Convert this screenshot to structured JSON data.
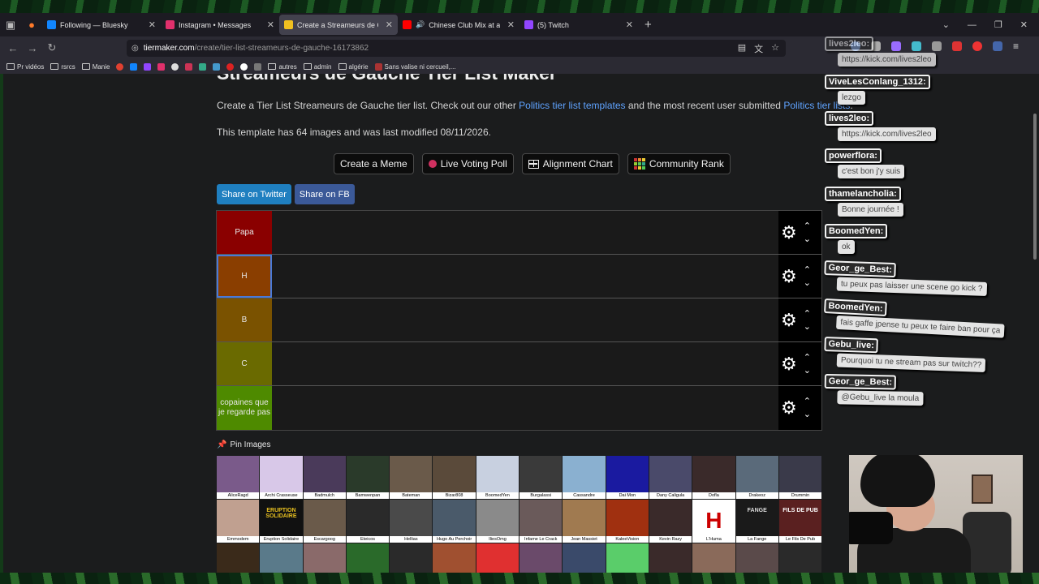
{
  "browser": {
    "tabs": [
      {
        "title": "Following — Bluesky",
        "favicon_color": "#1185fe",
        "active": false
      },
      {
        "title": "Instagram • Messages",
        "favicon_color": "#e1306c",
        "active": false
      },
      {
        "title": "Create a Streameurs de Gauche",
        "favicon_color": "#f0c020",
        "active": true
      },
      {
        "title": "Chinese Club Mix at a Senio",
        "favicon_color": "#ff0000",
        "active": false
      },
      {
        "title": "(5) Twitch",
        "favicon_color": "#9146ff",
        "active": false
      }
    ],
    "new_tab_glyph": "+",
    "url_host": "tiermaker.com",
    "url_path": "/create/tier-list-streameurs-de-gauche-16173862",
    "bookmarks": [
      {
        "label": "Pr vidéos",
        "type": "folder"
      },
      {
        "label": "rsrcs",
        "type": "folder"
      },
      {
        "label": "Manie",
        "type": "folder"
      },
      {
        "label": "autres",
        "type": "folder"
      },
      {
        "label": "admin",
        "type": "folder"
      },
      {
        "label": "algérie",
        "type": "folder"
      },
      {
        "label": "Sans valise ni cercueil,...",
        "type": "link"
      }
    ]
  },
  "page": {
    "title": "Streameurs de Gauche Tier List Maker",
    "intro_pre": "Create a Tier List Streameurs de Gauche tier list. Check out our other ",
    "intro_link1": "Politics tier list templates",
    "intro_mid": " and the most recent user submitted ",
    "intro_link2": "Politics tier lists",
    "intro_post": ".",
    "template_info": "This template has 64 images and was last modified 08/11/2026.",
    "buttons": {
      "create_meme": "Create a Meme",
      "live_voting": "Live Voting Poll",
      "alignment": "Alignment Chart",
      "community": "Community Rank"
    },
    "share": {
      "twitter": "Share on Twitter",
      "fb": "Share on FB",
      "twitter_color": "#1f7fc0",
      "fb_color": "#3b5998"
    },
    "tiers": [
      {
        "label": "Papa",
        "color": "#8a0000"
      },
      {
        "label": "H",
        "color": "#8a3e00"
      },
      {
        "label": "B",
        "color": "#7a5200"
      },
      {
        "label": "C",
        "color": "#6a6a00"
      },
      {
        "label": "copaines que je regarde pas",
        "color": "#4e8a00"
      }
    ],
    "pin_images": "Pin Images",
    "images_row1": [
      "AliceRagd",
      "Archi Crasseuse",
      "Badmulch",
      "Bamwenpan",
      "Bateman",
      "Bizar808",
      "BoomedYen",
      "Burgalassi",
      "Cassandre",
      "Dai Mon",
      "Dany Caligula",
      "Dofla",
      "Drakeoz",
      "Drummin"
    ],
    "images_row2": [
      "Emmodem",
      "Eruption Solidaire",
      "Escargoog",
      "Eteicos",
      "Hellias",
      "Hugo Au Perchoir",
      "IliesOmg",
      "Infame Le Crack",
      "Jean Massiet",
      "KaleeVision",
      "Kevin Razy",
      "L'Huma",
      "La Fange",
      "Le Fils De Pub"
    ],
    "image_text": {
      "eruption": "ERUPTION SOLIDAIRE",
      "huma": "H",
      "fils": "FILS DE PUB",
      "fange": "FANGE"
    }
  },
  "chat": [
    {
      "user": "lives2leo:",
      "text": "https://kick.com/lives2leo"
    },
    {
      "user": "ViveLesConlang_1312:",
      "text": "lezgo"
    },
    {
      "user": "lives2leo:",
      "text": "https://kick.com/lives2leo"
    },
    {
      "user": "powerflora:",
      "text": "c'est bon j'y suis"
    },
    {
      "user": "thamelancholia:",
      "text": "Bonne journée !"
    },
    {
      "user": "BoomedYen:",
      "text": "ok"
    },
    {
      "user": "Geor_ge_Best:",
      "text": "tu peux pas laisser une scene go kick ?"
    },
    {
      "user": "BoomedYen:",
      "text": "fais gaffe jpense tu peux te faire ban pour ça"
    },
    {
      "user": "Gebu_live:",
      "text": "Pourquoi tu ne stream pas sur twitch??"
    },
    {
      "user": "Geor_ge_Best:",
      "text": "@Gebu_live la moula"
    }
  ]
}
